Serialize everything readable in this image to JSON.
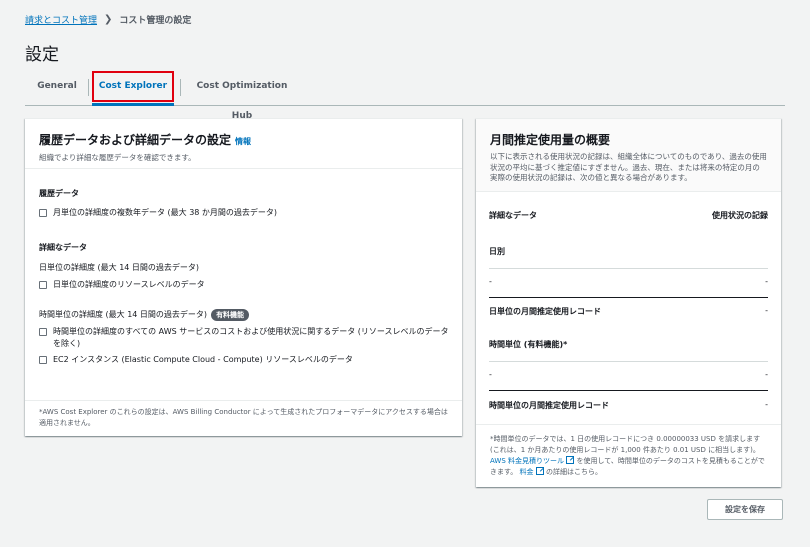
{
  "breadcrumb": {
    "parent": "請求とコスト管理",
    "current": "コスト管理の設定"
  },
  "page_title": "設定",
  "tabs": {
    "general": "General",
    "cost_explorer": "Cost Explorer",
    "coh": "Cost Optimization Hub"
  },
  "left": {
    "title": "履歴データおよび詳細データの設定",
    "info": "情報",
    "desc": "組織でより詳細な履歴データを確認できます。",
    "history_title": "履歴データ",
    "history_option": "月単位の詳細度の複数年データ (最大 38 か月間の過去データ)",
    "detail_title": "詳細なデータ",
    "daily_sub": "日単位の詳細度 (最大 14 日間の過去データ)",
    "daily_option": "日単位の詳細度のリソースレベルのデータ",
    "hourly_sub": "時間単位の詳細度 (最大 14 日間の過去データ)",
    "paid_badge": "有料機能",
    "hourly_option1": "時間単位の詳細度のすべての AWS サービスのコストおよび使用状況に関するデータ (リソースレベルのデータを除く)",
    "hourly_option2": "EC2 インスタンス (Elastic Compute Cloud - Compute) リソースレベルのデータ",
    "footnote": "*AWS Cost Explorer のこれらの設定は、AWS Billing Conductor によって生成されたプロフォーマデータにアクセスする場合は適用されません。"
  },
  "right": {
    "title": "月間推定使用量の概要",
    "desc": "以下に表示される使用状況の記録は、組織全体についてのものであり、過去の使用状況の平均に基づく推定値にすぎません。過去、現在、または将来の特定の月の実際の使用状況の記録は、次の値と異なる場合があります。",
    "col_left": "詳細なデータ",
    "col_right": "使用状況の記録",
    "daily": "日別",
    "dash": "-",
    "daily_monthly": "日単位の月間推定使用レコード",
    "hourly": "時間単位 (有料機能)*",
    "hourly_monthly": "時間単位の月間推定使用レコード",
    "note_a": "*時間単位のデータでは、1 日の使用レコードにつき 0.00000033 USD を請求します (これは、1 か月あたりの使用レコードが 1,000 件あたり 0.01 USD に相当します)。",
    "note_link1": "AWS 料金見積りツール",
    "note_b": "を使用して、時間単位のデータのコストを見積もることができます。",
    "note_link2": "料金",
    "note_c": "の詳細はこちら。"
  },
  "save_button": "設定を保存"
}
